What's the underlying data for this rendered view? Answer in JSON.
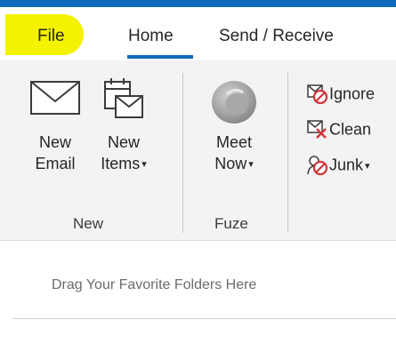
{
  "tabs": {
    "file": "File",
    "home": "Home",
    "send_receive": "Send / Receive"
  },
  "ribbon": {
    "new_email": {
      "line1": "New",
      "line2": "Email",
      "icon": "envelope-icon"
    },
    "new_items": {
      "line1": "New",
      "line2": "Items",
      "icon": "new-items-icon"
    },
    "meet_now": {
      "line1": "Meet",
      "line2": "Now",
      "icon": "meet-now-icon"
    },
    "group_new": "New",
    "group_fuze": "Fuze",
    "ignore": {
      "label": "Ignore",
      "icon": "ignore-icon"
    },
    "clean_up": {
      "label": "Clean",
      "icon": "clean-up-icon"
    },
    "junk": {
      "label": "Junk",
      "icon": "junk-icon"
    },
    "dropdown_caret": "▾"
  },
  "folders": {
    "hint": "Drag Your Favorite Folders Here"
  },
  "colors": {
    "accent": "#0f6cbd",
    "highlight": "#f5f200",
    "ribbon_bg": "#f3f3f3",
    "block_red": "#d13438"
  }
}
